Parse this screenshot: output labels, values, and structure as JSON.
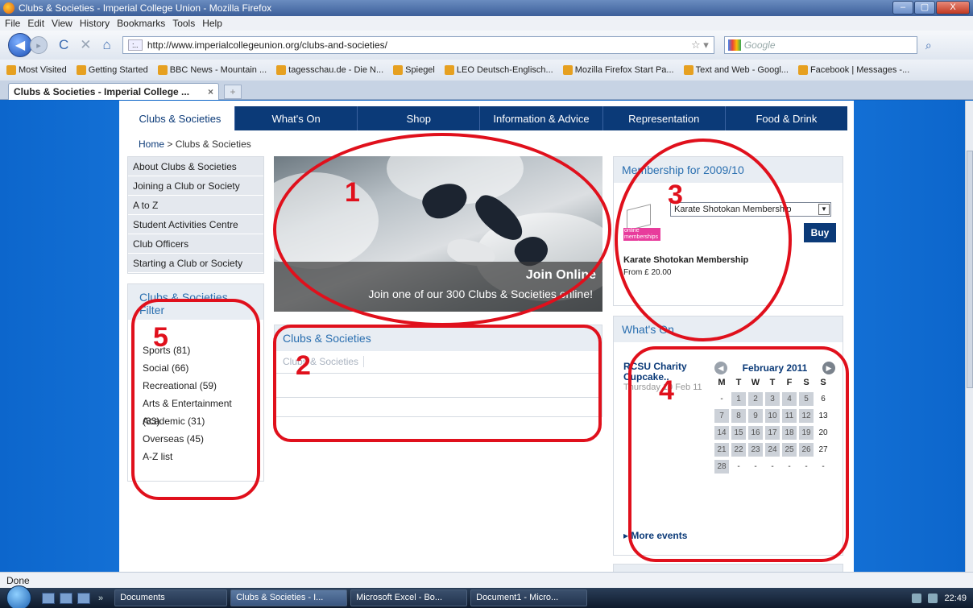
{
  "window": {
    "title": "Clubs & Societies - Imperial College Union - Mozilla Firefox",
    "controls": [
      "–",
      "▢",
      "X"
    ]
  },
  "menu": [
    "File",
    "Edit",
    "View",
    "History",
    "Bookmarks",
    "Tools",
    "Help"
  ],
  "browser": {
    "url": "http://www.imperialcollegeunion.org/clubs-and-societies/",
    "search_placeholder": "Google",
    "back_glyph": "◀",
    "forward_glyph": "▸",
    "reload_glyph": "C",
    "stop_glyph": "✕",
    "home_glyph": "⌂",
    "star_glyph": "☆ ▾",
    "search_glyph": "⌕",
    "site_icon_text": ":.."
  },
  "bookmarks": [
    "Most Visited",
    "Getting Started",
    "BBC News - Mountain ...",
    "tagesschau.de - Die N...",
    "Spiegel",
    "LEO Deutsch-Englisch...",
    "Mozilla Firefox Start Pa...",
    "Text and Web - Googl...",
    "Facebook | Messages -..."
  ],
  "tab": {
    "label": "Clubs & Societies - Imperial College ...",
    "close": "×",
    "new_tab": "+"
  },
  "site": {
    "nav": [
      "Clubs & Societies",
      "What's On",
      "Shop",
      "Information & Advice",
      "Representation",
      "Food & Drink"
    ],
    "breadcrumb": {
      "home": "Home",
      "sep": " > ",
      "current": "Clubs & Societies"
    },
    "sidebar": [
      "About Clubs & Societies",
      "Joining a Club or Society",
      "A to Z",
      "Student Activities Centre",
      "Club Officers",
      "Starting a Club or Society"
    ],
    "filter": {
      "title": "Clubs & Societies Filter",
      "items": [
        "Sports (81)",
        "Social (66)",
        "Recreational (59)",
        "Arts & Entertainment (33)",
        "Academic (31)",
        "Overseas (45)",
        "A-Z list"
      ]
    },
    "hero": {
      "title": "Join Online",
      "text": "Join one of our 300 Clubs & Societies online!"
    },
    "clubs_box": {
      "title": "Clubs & Societies",
      "tab": "Clubs & Societies"
    },
    "membership": {
      "title": "Membership for 2009/10",
      "selected": "Karate Shotokan Membership",
      "dropdown_glyph": "▼",
      "buy": "Buy",
      "product": "Karate Shotokan Membership",
      "price": "From £ 20.00",
      "thumb_text": "online memberships",
      "thumb_sub": "2010/11"
    },
    "whats_on": {
      "title": "What's On",
      "event_title": "RCSU Charity Cupcake..",
      "event_date": "Thursday 10 Feb 11",
      "month": "February 2011",
      "prev_glyph": "◀",
      "next_glyph": "▶",
      "weekdays": [
        "M",
        "T",
        "W",
        "T",
        "F",
        "S",
        "S"
      ],
      "days": [
        "-",
        "1",
        "2",
        "3",
        "4",
        "5",
        "6",
        "7",
        "8",
        "9",
        "10",
        "11",
        "12",
        "13",
        "14",
        "15",
        "16",
        "17",
        "18",
        "19",
        "20",
        "21",
        "22",
        "23",
        "24",
        "25",
        "26",
        "27",
        "28",
        "-",
        "-",
        "-",
        "-",
        "-",
        "-"
      ],
      "more": "▸ More events"
    }
  },
  "annotations": [
    "1",
    "2",
    "3",
    "4",
    "5"
  ],
  "status": "Done",
  "taskbar": {
    "chevron": "»",
    "tasks": [
      "Documents",
      "Clubs & Societies - I...",
      "Microsoft Excel - Bo...",
      "Document1 - Micro..."
    ],
    "clock": "22:49"
  }
}
